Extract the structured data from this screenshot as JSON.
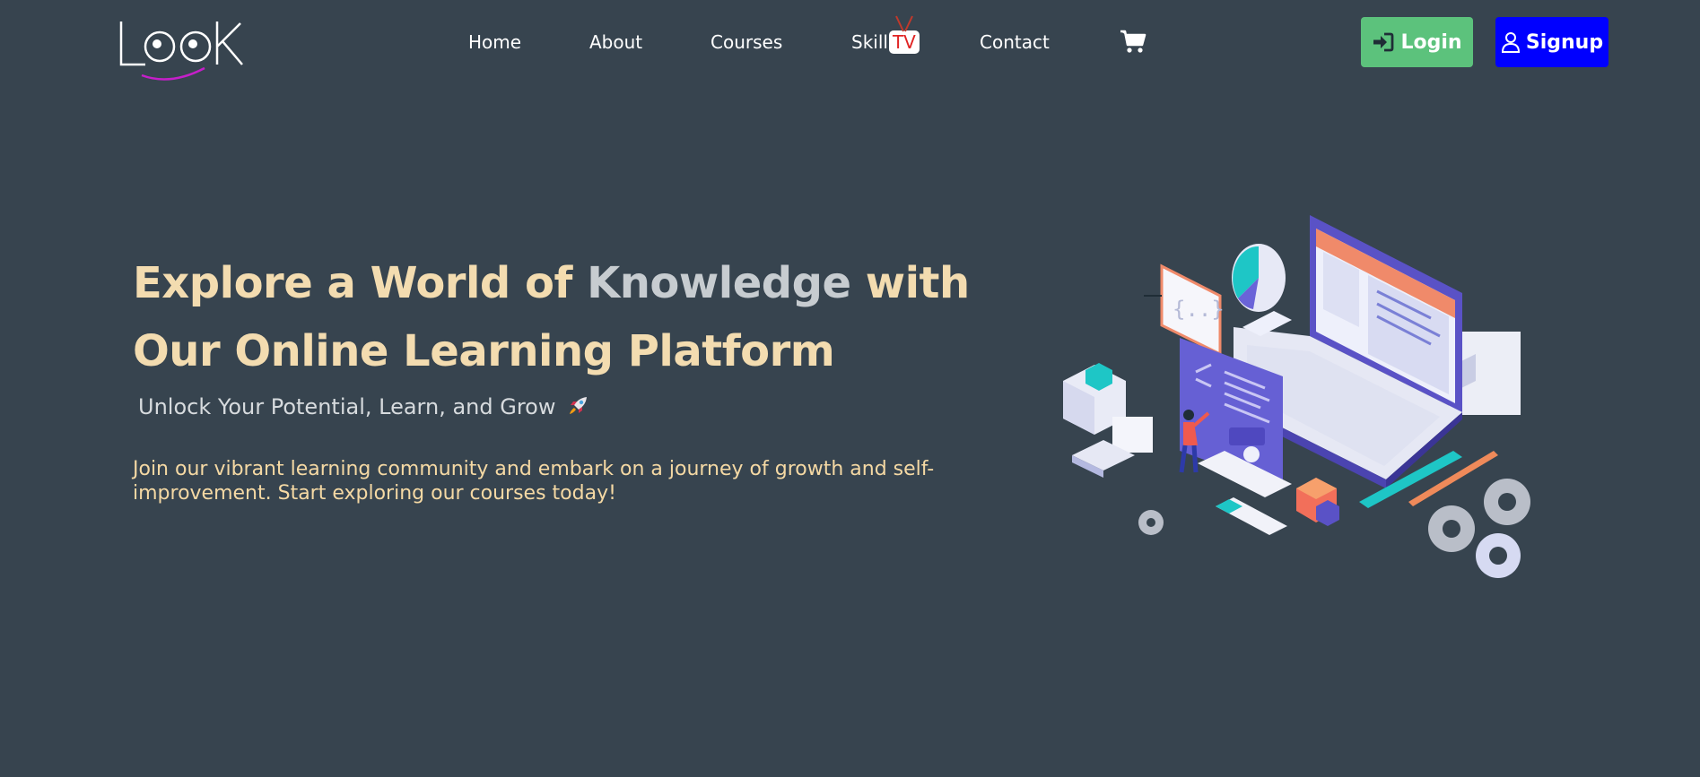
{
  "brand": {
    "logo_text": "LooK"
  },
  "nav": {
    "home": "Home",
    "about": "About",
    "courses": "Courses",
    "skill": "Skill",
    "tv": "TV",
    "contact": "Contact",
    "cart_icon": "shopping-cart-icon"
  },
  "auth": {
    "login_label": "Login",
    "signup_label": "Signup",
    "login_color": "#5cc27c",
    "signup_color": "#0000ff"
  },
  "hero": {
    "title_part1": "Explore a World of ",
    "title_highlight": "Knowledge",
    "title_part2": " with Our Online Learning Platform",
    "subtitle": "Unlock Your Potential, Learn, and Grow",
    "description": "Join our vibrant learning community and embark on a journey of growth and self-improvement. Start exploring our courses today!"
  },
  "colors": {
    "background": "#37444f",
    "title": "#f3dcb0",
    "highlight": "#c7ccd0",
    "description": "#f5d9a4"
  }
}
